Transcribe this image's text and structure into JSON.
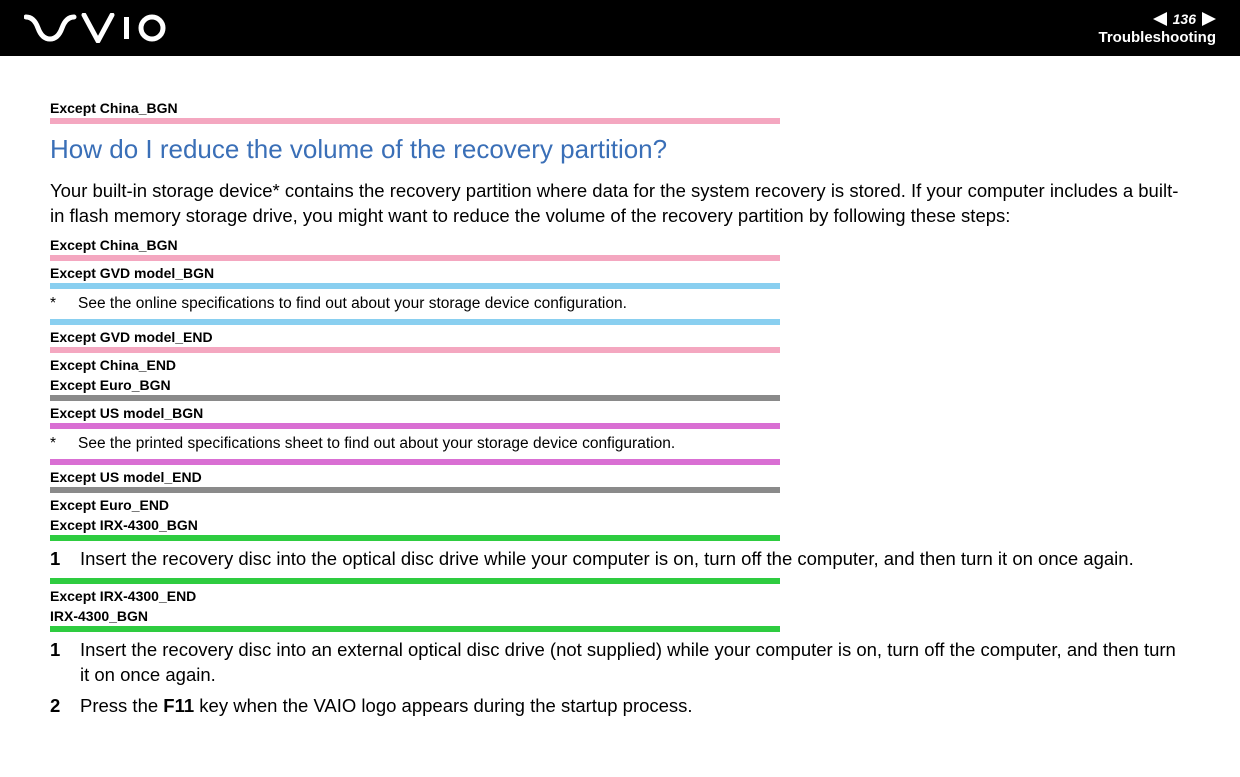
{
  "header": {
    "page_number": "136",
    "section": "Troubleshooting"
  },
  "tags": {
    "except_china_bgn": "Except China_BGN",
    "except_china_bgn2": "Except China_BGN",
    "except_gvd_bgn": "Except GVD model_BGN",
    "except_gvd_end": "Except GVD model_END",
    "except_china_end": "Except China_END",
    "except_euro_bgn": "Except Euro_BGN",
    "except_us_bgn": "Except US model_BGN",
    "except_us_end": "Except US model_END",
    "except_euro_end": "Except Euro_END",
    "except_irx4300_bgn": "Except IRX-4300_BGN",
    "except_irx4300_end": "Except IRX-4300_END",
    "irx4300_bgn": "IRX-4300_BGN"
  },
  "heading": "How do I reduce the volume of the recovery partition?",
  "intro": "Your built-in storage device* contains the recovery partition where data for the system recovery is stored. If your computer includes a built-in flash memory storage drive, you might want to reduce the volume of the recovery partition by following these steps:",
  "footnotes": {
    "online": "See the online specifications to find out about your storage device configuration.",
    "printed": "See the printed specifications sheet to find out about your storage device configuration."
  },
  "steps": {
    "step1a_num": "1",
    "step1a": "Insert the recovery disc into the optical disc drive while your computer is on, turn off the computer, and then turn it on once again.",
    "step1b_num": "1",
    "step1b": "Insert the recovery disc into an external optical disc drive (not supplied) while your computer is on, turn off the computer, and then turn it on once again.",
    "step2_num": "2",
    "step2_pre": "Press the ",
    "step2_key": "F11",
    "step2_post": " key when the VAIO logo appears during the startup process."
  }
}
